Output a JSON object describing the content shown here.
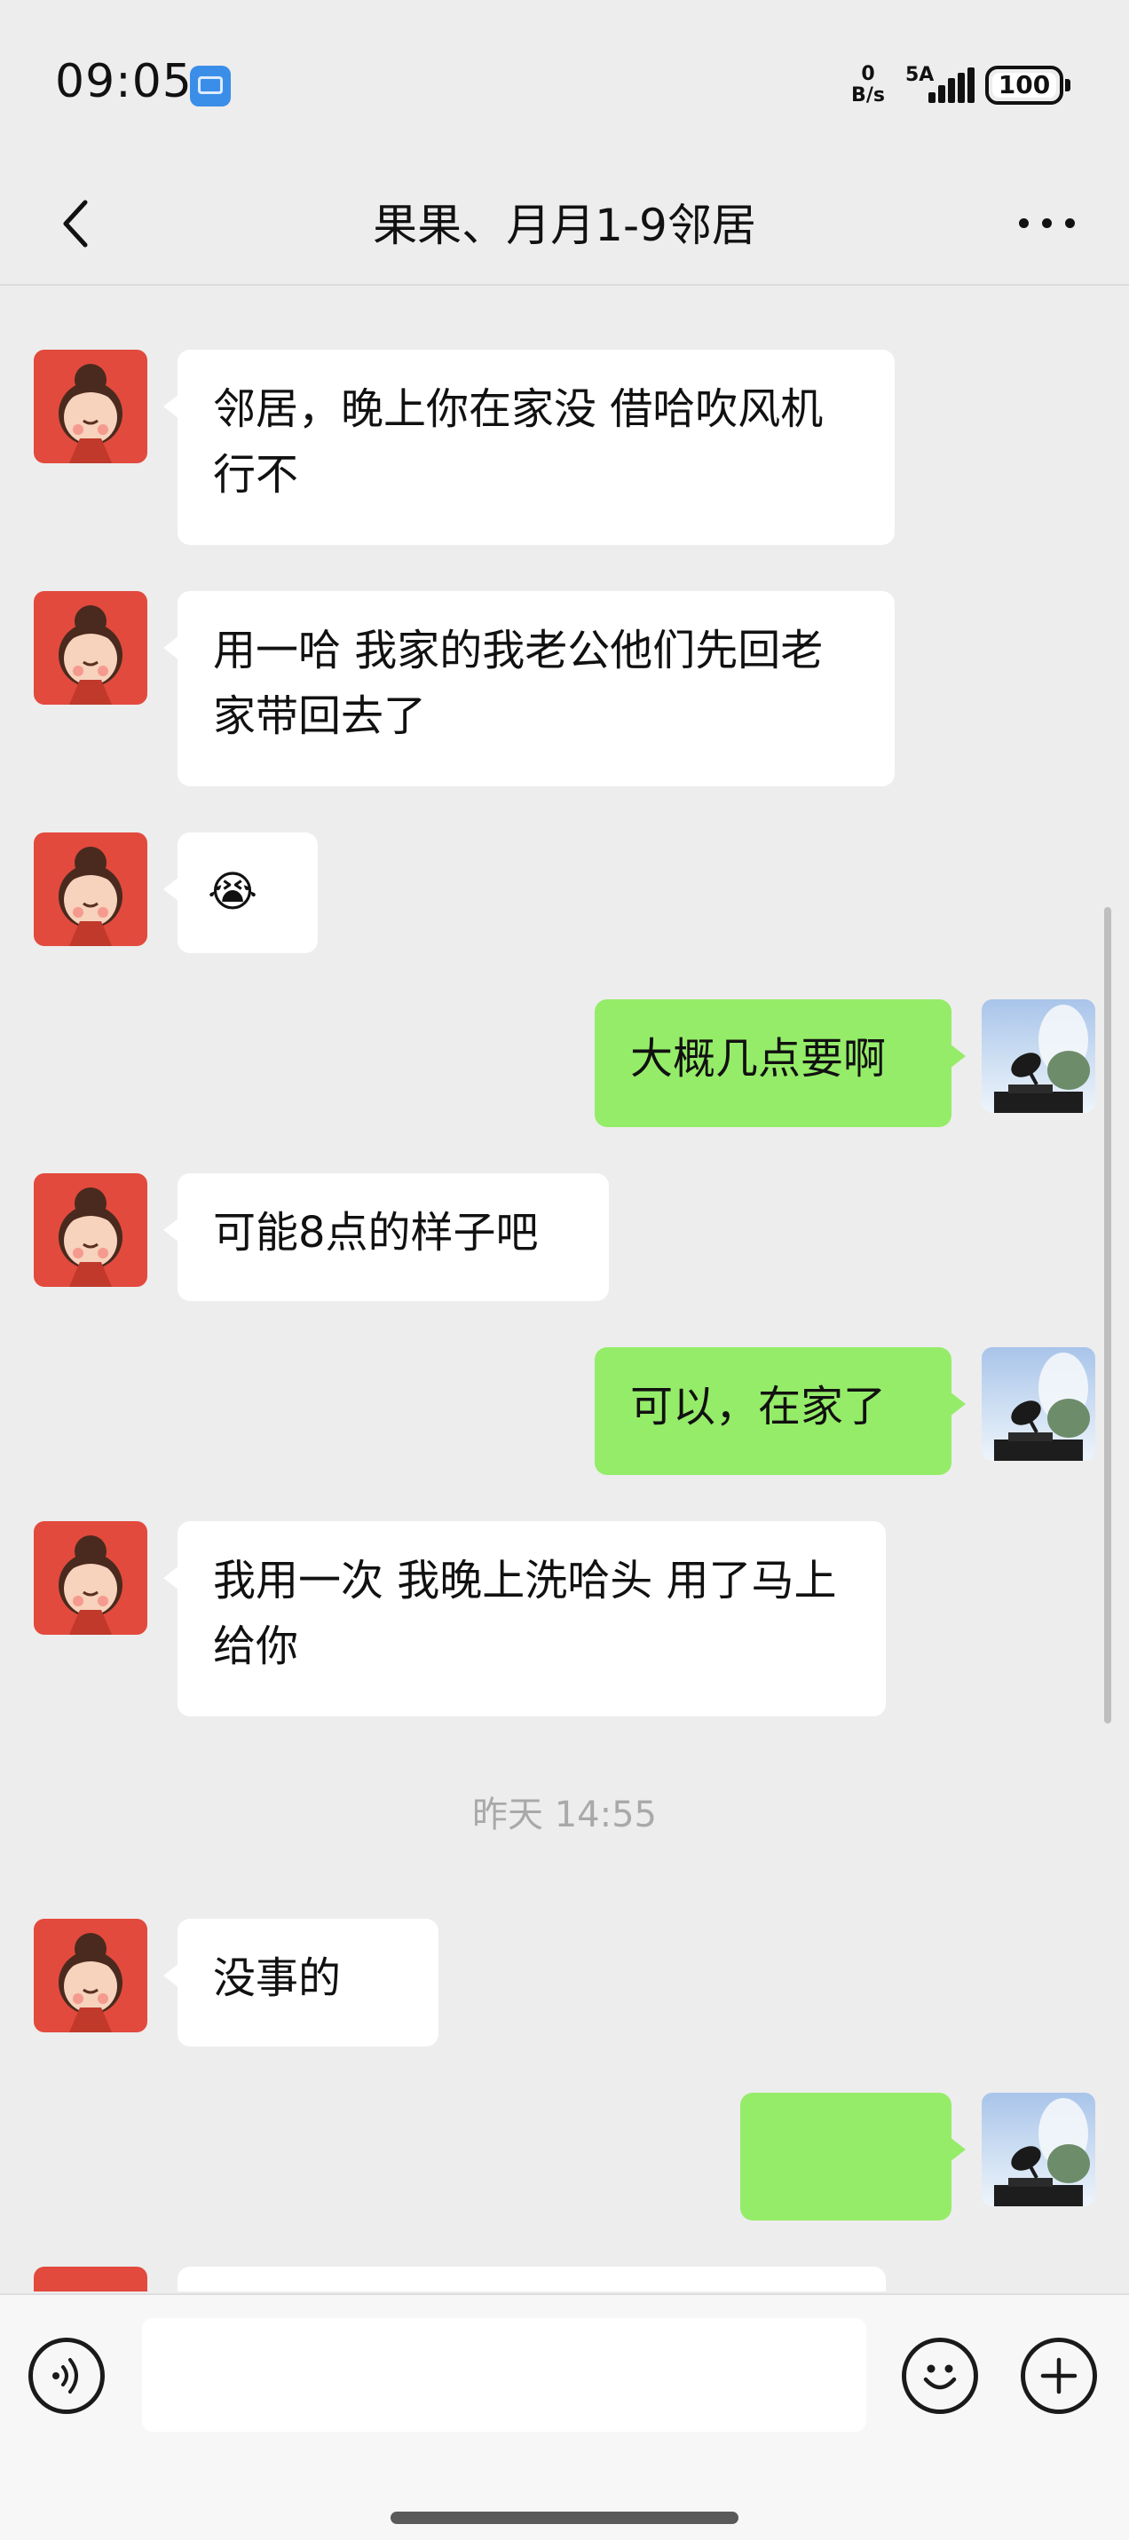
{
  "status_bar": {
    "time": "09:05",
    "net_speed_value": "0",
    "net_speed_unit": "B/s",
    "network_label": "5A",
    "battery": "100"
  },
  "header": {
    "title": "果果、月月1-9邻居"
  },
  "messages": [
    {
      "side": "in",
      "text": "邻居，晚上你在家没  借哈吹风机行不"
    },
    {
      "side": "in",
      "text": "用一哈  我家的我老公他们先回老家带回去了"
    },
    {
      "side": "in",
      "text": "😭"
    },
    {
      "side": "out",
      "text": "大概几点要啊"
    },
    {
      "side": "in",
      "text": "可能8点的样子吧"
    },
    {
      "side": "out",
      "text": "可以，在家了"
    },
    {
      "side": "in",
      "text": "我用一次   我晚上洗哈头  用了马上给你"
    },
    {
      "side": "out",
      "text": "没事的"
    }
  ],
  "timestamp": "昨天 14:55",
  "colors": {
    "background": "#ededed",
    "incoming_bubble": "#ffffff",
    "outgoing_bubble": "#95ec69",
    "incoming_avatar": "#e24a3d"
  },
  "input_bar": {
    "voice_icon": "voice-icon",
    "emoji_icon": "emoji-icon",
    "plus_icon": "plus-icon",
    "input_value": ""
  }
}
